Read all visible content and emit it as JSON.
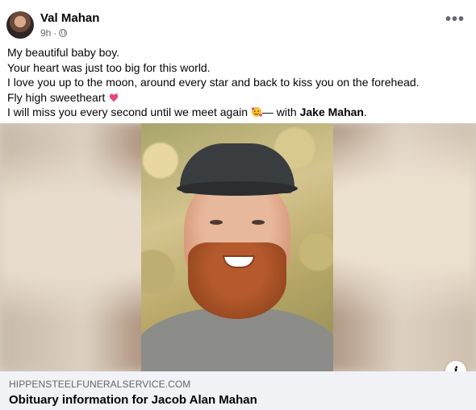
{
  "post": {
    "author": "Val Mahan",
    "time": "9h",
    "meta_separator": "·",
    "privacy_icon": "globe-icon",
    "more_icon": "more-horizontal-icon",
    "more_label": "•••",
    "lines": [
      "My beautiful baby boy.",
      "Your heart was just too big for this world.",
      "I love you up to the moon, around every star and back to kiss you on the forehead.",
      "Fly high sweetheart",
      "I will miss you every second until we meet again"
    ],
    "with_text": "— with",
    "tagged_person": "Jake Mahan",
    "end_punct": "."
  },
  "link": {
    "domain": "HIPPENSTEELFUNERALSERVICE.COM",
    "title": "Obituary information for Jacob Alan Mahan",
    "info_icon": "info-icon",
    "info_label": "i"
  },
  "colors": {
    "text_primary": "#050505",
    "text_secondary": "#65676b",
    "link_card_bg": "#f0f2f5",
    "heart_emoji": "#e8457a"
  }
}
